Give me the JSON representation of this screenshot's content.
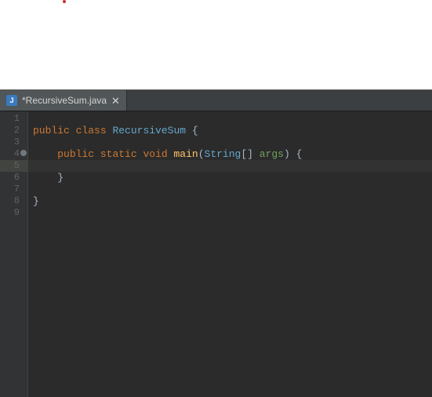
{
  "tab": {
    "file_label": "*RecursiveSum.java",
    "icon_letter": "J",
    "close_glyph": "✕"
  },
  "gutter": {
    "lines": [
      "1",
      "2",
      "3",
      "4",
      "5",
      "6",
      "7",
      "8",
      "9"
    ],
    "current_line": 5,
    "marker_line": 4
  },
  "code": {
    "lines": [
      {
        "indent": 0,
        "tokens": []
      },
      {
        "indent": 0,
        "tokens": [
          {
            "cls": "kw",
            "t": "public"
          },
          {
            "cls": "punc",
            "t": " "
          },
          {
            "cls": "kw",
            "t": "class"
          },
          {
            "cls": "punc",
            "t": " "
          },
          {
            "cls": "cls",
            "t": "RecursiveSum"
          },
          {
            "cls": "punc",
            "t": " {"
          }
        ]
      },
      {
        "indent": 0,
        "tokens": []
      },
      {
        "indent": 1,
        "tokens": [
          {
            "cls": "kw",
            "t": "public"
          },
          {
            "cls": "punc",
            "t": " "
          },
          {
            "cls": "kw",
            "t": "static"
          },
          {
            "cls": "punc",
            "t": " "
          },
          {
            "cls": "kw",
            "t": "void"
          },
          {
            "cls": "punc",
            "t": " "
          },
          {
            "cls": "method",
            "t": "main"
          },
          {
            "cls": "punc",
            "t": "("
          },
          {
            "cls": "cls",
            "t": "String"
          },
          {
            "cls": "punc",
            "t": "[] "
          },
          {
            "cls": "args",
            "t": "args"
          },
          {
            "cls": "punc",
            "t": ") {"
          }
        ]
      },
      {
        "indent": 0,
        "tokens": []
      },
      {
        "indent": 1,
        "tokens": [
          {
            "cls": "punc",
            "t": "}"
          }
        ]
      },
      {
        "indent": 0,
        "tokens": []
      },
      {
        "indent": 0,
        "tokens": [
          {
            "cls": "punc",
            "t": "}"
          }
        ]
      },
      {
        "indent": 0,
        "tokens": []
      }
    ]
  },
  "colors": {
    "editor_bg": "#2b2b2b",
    "gutter_bg": "#313335",
    "tabbar_bg": "#3c3f41",
    "keyword": "#cc7832",
    "class": "#66a7cd",
    "method": "#ffc66d",
    "default": "#a9b7c6"
  }
}
